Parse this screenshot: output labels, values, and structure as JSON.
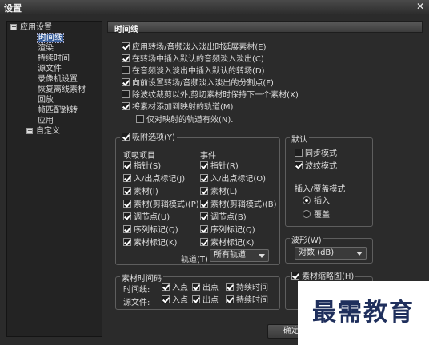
{
  "window": {
    "title": "设置",
    "close_glyph": "✕"
  },
  "tree": {
    "items": [
      {
        "label": "应用设置",
        "toggle": "−",
        "level": 0
      },
      {
        "label": "时间线",
        "level": 1,
        "selected": true
      },
      {
        "label": "渲染",
        "level": 1
      },
      {
        "label": "持续时间",
        "level": 1
      },
      {
        "label": "源文件",
        "level": 1
      },
      {
        "label": "录像机设置",
        "level": 1
      },
      {
        "label": "恢复离线素材",
        "level": 1
      },
      {
        "label": "回放",
        "level": 1
      },
      {
        "label": "帧匹配跳转",
        "level": 1
      },
      {
        "label": "应用",
        "level": 1
      },
      {
        "label": "自定义",
        "toggle": "+",
        "level": 0
      }
    ]
  },
  "panel": {
    "title": "时间线",
    "options": [
      {
        "label": "应用转场/音频淡入淡出时延展素材(E)",
        "checked": true
      },
      {
        "label": "在转场中插入默认的音频淡入淡出(C)",
        "checked": true
      },
      {
        "label": "在音频淡入淡出中插入默认的转场(D)",
        "checked": false
      },
      {
        "label": "向前设置转场/音频淡入淡出的分割点(F)",
        "checked": true
      },
      {
        "label": "除波纹裁剪以外,剪切素材时保持下一个素材(X)",
        "checked": false
      },
      {
        "label": "将素材添加到映射的轨道(M)",
        "checked": true
      },
      {
        "label": "仅对映射的轨道有效(N).",
        "checked": false
      }
    ],
    "snap": {
      "label": "吸附选项(Y)",
      "checked": true,
      "col1_header": "项吸项目",
      "col2_header": "事件",
      "col1": [
        {
          "label": "指针(S)",
          "checked": true
        },
        {
          "label": "入/出点标记(J)",
          "checked": true
        },
        {
          "label": "素材(I)",
          "checked": true
        },
        {
          "label": "素材(剪辑模式)(P)",
          "checked": true
        },
        {
          "label": "调节点(U)",
          "checked": true
        },
        {
          "label": "序列标记(Q)",
          "checked": true
        },
        {
          "label": "素材标记(K)",
          "checked": true
        }
      ],
      "col2": [
        {
          "label": "指针(R)",
          "checked": true
        },
        {
          "label": "入/出点标记(O)",
          "checked": true
        },
        {
          "label": "素材(L)",
          "checked": true
        },
        {
          "label": "素材(剪辑模式)(B)",
          "checked": true
        },
        {
          "label": "调节点(B)",
          "checked": true
        },
        {
          "label": "序列标记(Q)",
          "checked": true
        },
        {
          "label": "素材标记(K)",
          "checked": true
        }
      ],
      "track_label": "轨道(T)",
      "track_value": "所有轨道"
    },
    "default": {
      "label": "默认",
      "sync": {
        "label": "同步模式",
        "checked": false
      },
      "ripple": {
        "label": "波纹模式",
        "checked": true
      },
      "insert_label": "插入/覆盖模式",
      "insert": {
        "label": "插入",
        "selected": true
      },
      "overwrite": {
        "label": "覆盖",
        "selected": false
      }
    },
    "waveform": {
      "label": "波形(W)",
      "value": "对数 (dB)"
    },
    "timecode": {
      "label": "素材时间码",
      "rows": [
        {
          "label": "时间线:",
          "in": "入点",
          "out": "出点",
          "dur": "持续时间"
        },
        {
          "label": "源文件:",
          "in": "入点",
          "out": "出点",
          "dur": "持续时间"
        }
      ]
    },
    "thumbnail": {
      "label": "素材缩略图(H)",
      "checked": true
    },
    "ok_label": "确定"
  },
  "watermark": {
    "text": "最需教育"
  }
}
